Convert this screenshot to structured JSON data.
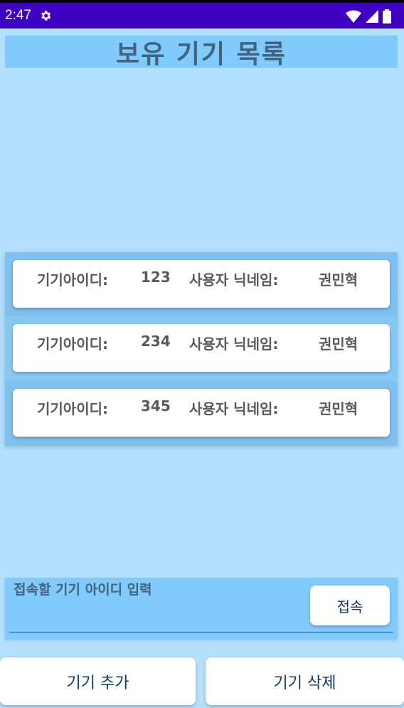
{
  "status_bar": {
    "time": "2:47"
  },
  "title": "보유 기기 목록",
  "devices": [
    {
      "id_label": "기기아이디:",
      "id": "123",
      "nick_label": "사용자 닉네임:",
      "nickname": "권민혁"
    },
    {
      "id_label": "기기아이디:",
      "id": "234",
      "nick_label": "사용자 닉네임:",
      "nickname": "권민혁"
    },
    {
      "id_label": "기기아이디:",
      "id": "345",
      "nick_label": "사용자 닉네임:",
      "nickname": "권민혁"
    }
  ],
  "connect": {
    "placeholder": "접속할 기기 아이디 입력",
    "button_label": "접속"
  },
  "buttons": {
    "add": "기기 추가",
    "delete": "기기 삭제"
  },
  "colors": {
    "status_bar": "#3f00c4",
    "background": "#b3e0fd",
    "title_bar": "#80cafc",
    "list_bg": "#80c3ef"
  }
}
